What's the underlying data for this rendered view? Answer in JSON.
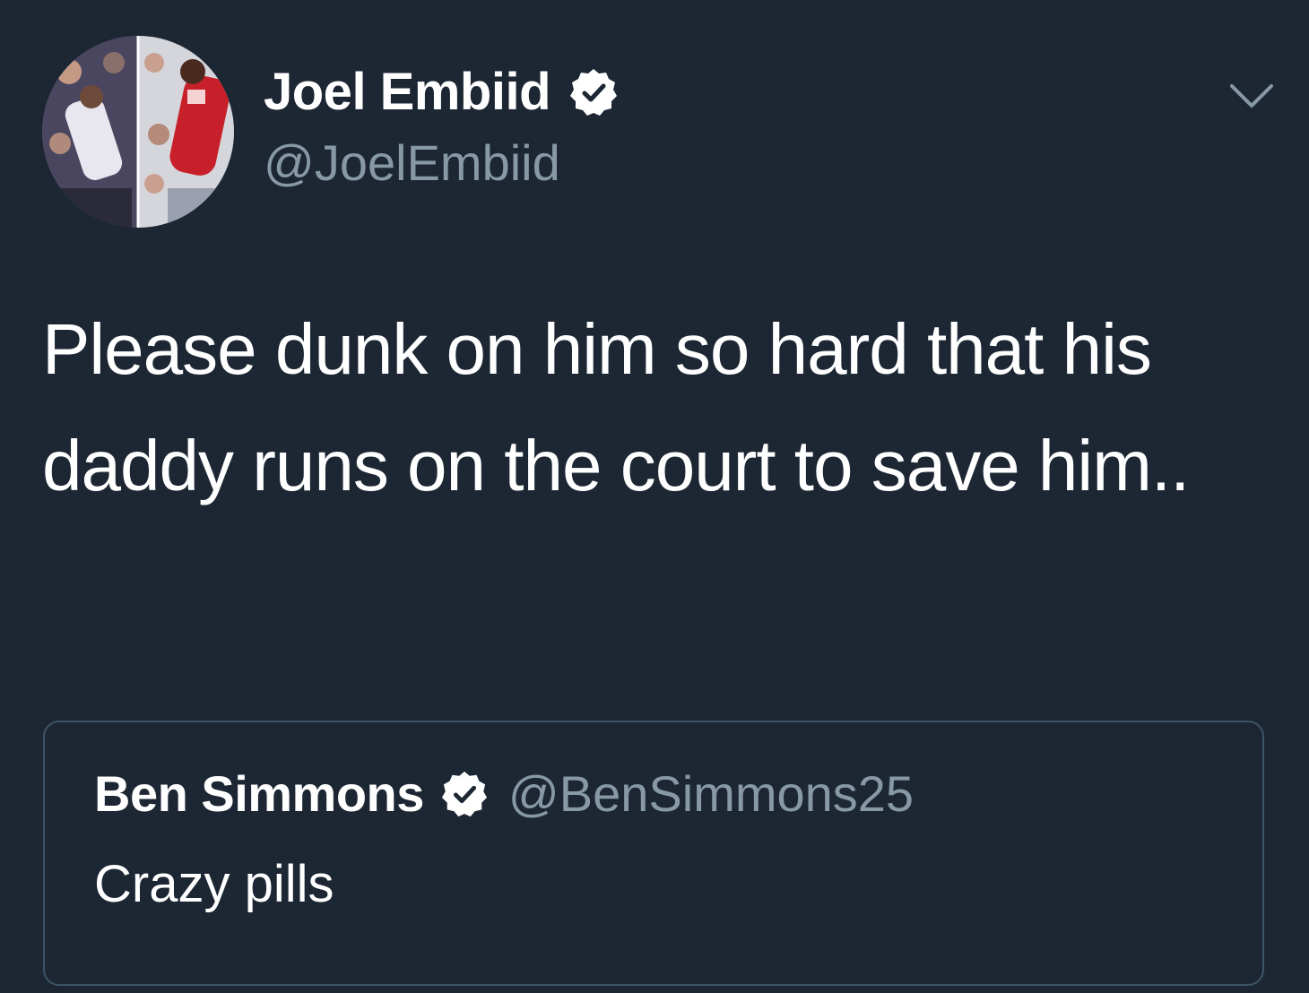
{
  "tweet": {
    "display_name": "Joel Embiid",
    "handle": "@JoelEmbiid",
    "text": "Please dunk on him so hard that his daddy runs on the court to save him..",
    "verified": true,
    "avatar_icon": "profile-photo"
  },
  "quoted_tweet": {
    "display_name": "Ben Simmons",
    "handle": "@BenSimmons25",
    "text": "Crazy pills",
    "verified": true
  },
  "menu": {
    "icon": "chevron-down-icon"
  },
  "colors": {
    "background": "#1c2733",
    "text_primary": "#ffffff",
    "text_secondary": "#8899a6",
    "quote_border": "#3d5466"
  }
}
